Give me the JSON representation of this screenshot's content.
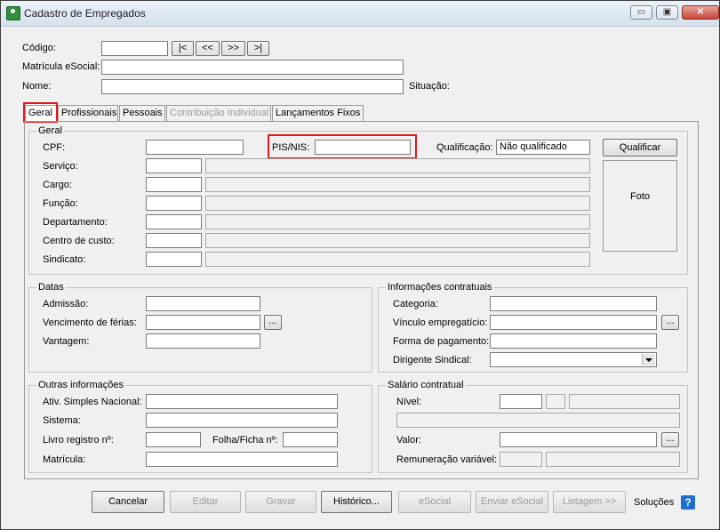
{
  "window": {
    "title": "Cadastro de Empregados",
    "minimize": "▭",
    "maximize": "▣",
    "close": "✕"
  },
  "header": {
    "codigo_label": "Código:",
    "matricula_label": "Matrícula eSocial:",
    "nome_label": "Nome:",
    "situacao_label": "Situação:",
    "nav": [
      "|<",
      "<<",
      ">>",
      ">|"
    ]
  },
  "tabs": [
    "Geral",
    "Profissionais",
    "Pessoais",
    "Contribuição Individual",
    "Lançamentos Fixos"
  ],
  "geral": {
    "group_title": "Geral",
    "cpf_label": "CPF:",
    "pis_label": "PIS/NIS:",
    "qualificacao_label": "Qualificação:",
    "qualificacao_value": "Não qualificado",
    "qualificar_button": "Qualificar",
    "foto_label": "Foto",
    "servico_label": "Serviço:",
    "cargo_label": "Cargo:",
    "funcao_label": "Função:",
    "departamento_label": "Departamento:",
    "centro_custo_label": "Centro de custo:",
    "sindicato_label": "Sindicato:"
  },
  "datas": {
    "group_title": "Datas",
    "admissao_label": "Admissão:",
    "vencimento_label": "Vencimento de férias:",
    "vantagem_label": "Vantagem:",
    "browse": "..."
  },
  "contratuais": {
    "group_title": "Informações contratuais",
    "categoria_label": "Categoria:",
    "vinculo_label": "Vínculo empregatício:",
    "forma_pagamento_label": "Forma de pagamento:",
    "dirigente_label": "Dirigente Sindical:",
    "browse": "..."
  },
  "outras": {
    "group_title": "Outras informações",
    "simples_label": "Ativ. Simples Nacional:",
    "sistema_label": "Sistema:",
    "livro_label": "Livro registro nº:",
    "folha_label": "Folha/Ficha nº:",
    "matricula_label": "Matrícula:"
  },
  "salario": {
    "group_title": "Salário contratual",
    "nivel_label": "Nível:",
    "valor_label": "Valor:",
    "remuneracao_label": "Remuneração variável:",
    "browse": "..."
  },
  "footer": {
    "cancelar": "Cancelar",
    "editar": "Editar",
    "gravar": "Gravar",
    "historico": "Histórico...",
    "esocial": "eSocial",
    "enviar_esocial": "Enviar eSocial",
    "listagem": "Listagem >>",
    "solucoes": "Soluções",
    "help": "?"
  },
  "colors": {
    "highlight": "#e01818",
    "help_icon": "#1f6fd0",
    "app_icon": "#2f8f3a"
  }
}
